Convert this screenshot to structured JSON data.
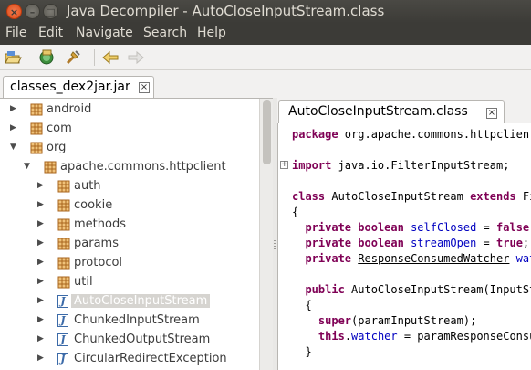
{
  "window": {
    "title": "Java Decompiler - AutoCloseInputStream.class"
  },
  "menu": [
    "File",
    "Edit",
    "Navigate",
    "Search",
    "Help"
  ],
  "toolbar": {
    "buttons": [
      {
        "icon": "open-folder-icon"
      },
      {
        "icon": "open-type-icon"
      },
      {
        "icon": "search-icon"
      },
      {
        "icon": "back-arrow-icon"
      },
      {
        "icon": "forward-arrow-icon"
      }
    ]
  },
  "left_tab": {
    "label": "classes_dex2jar.jar"
  },
  "tree": [
    {
      "label": "android",
      "depth": 0,
      "expanded": false,
      "kind": "package"
    },
    {
      "label": "com",
      "depth": 0,
      "expanded": false,
      "kind": "package"
    },
    {
      "label": "org",
      "depth": 0,
      "expanded": true,
      "kind": "package"
    },
    {
      "label": "apache.commons.httpclient",
      "depth": 1,
      "expanded": true,
      "kind": "package"
    },
    {
      "label": "auth",
      "depth": 2,
      "expanded": false,
      "kind": "package"
    },
    {
      "label": "cookie",
      "depth": 2,
      "expanded": false,
      "kind": "package"
    },
    {
      "label": "methods",
      "depth": 2,
      "expanded": false,
      "kind": "package"
    },
    {
      "label": "params",
      "depth": 2,
      "expanded": false,
      "kind": "package"
    },
    {
      "label": "protocol",
      "depth": 2,
      "expanded": false,
      "kind": "package"
    },
    {
      "label": "util",
      "depth": 2,
      "expanded": false,
      "kind": "package"
    },
    {
      "label": "AutoCloseInputStream",
      "depth": 2,
      "expanded": false,
      "kind": "class",
      "selected": true
    },
    {
      "label": "ChunkedInputStream",
      "depth": 2,
      "expanded": false,
      "kind": "class"
    },
    {
      "label": "ChunkedOutputStream",
      "depth": 2,
      "expanded": false,
      "kind": "class"
    },
    {
      "label": "CircularRedirectException",
      "depth": 2,
      "expanded": false,
      "kind": "class"
    }
  ],
  "right_tab": {
    "label": "AutoCloseInputStream.class"
  },
  "code_lines": [
    [
      {
        "t": "package",
        "s": "kw"
      },
      {
        "t": " org.apache.commons.httpclient"
      }
    ],
    [],
    [
      {
        "t": "import",
        "s": "kw"
      },
      {
        "t": " java.io.FilterInputStream;"
      }
    ],
    [],
    [
      {
        "t": "class",
        "s": "kw"
      },
      {
        "t": " AutoCloseInputStream "
      },
      {
        "t": "extends",
        "s": "kw"
      },
      {
        "t": " Fi"
      }
    ],
    [
      {
        "t": "{"
      }
    ],
    [
      {
        "t": "  "
      },
      {
        "t": "private",
        "s": "kw"
      },
      {
        "t": " "
      },
      {
        "t": "boolean",
        "s": "kw"
      },
      {
        "t": " "
      },
      {
        "t": "selfClosed",
        "s": "fld"
      },
      {
        "t": " = "
      },
      {
        "t": "false",
        "s": "kw"
      },
      {
        "t": ";"
      }
    ],
    [
      {
        "t": "  "
      },
      {
        "t": "private",
        "s": "kw"
      },
      {
        "t": " "
      },
      {
        "t": "boolean",
        "s": "kw"
      },
      {
        "t": " "
      },
      {
        "t": "streamOpen",
        "s": "fld"
      },
      {
        "t": " = "
      },
      {
        "t": "true",
        "s": "kw"
      },
      {
        "t": ";"
      }
    ],
    [
      {
        "t": "  "
      },
      {
        "t": "private",
        "s": "kw"
      },
      {
        "t": " "
      },
      {
        "t": "ResponseConsumedWatcher",
        "s": "ul"
      },
      {
        "t": " "
      },
      {
        "t": "wat",
        "s": "fld"
      }
    ],
    [],
    [
      {
        "t": "  "
      },
      {
        "t": "public",
        "s": "kw"
      },
      {
        "t": " AutoCloseInputStream(InputSt"
      }
    ],
    [
      {
        "t": "  {"
      }
    ],
    [
      {
        "t": "    "
      },
      {
        "t": "super",
        "s": "kw"
      },
      {
        "t": "(paramInputStream);"
      }
    ],
    [
      {
        "t": "    "
      },
      {
        "t": "this",
        "s": "kw"
      },
      {
        "t": "."
      },
      {
        "t": "watcher",
        "s": "fld"
      },
      {
        "t": " = paramResponseConsu"
      }
    ],
    [
      {
        "t": "  }"
      }
    ]
  ]
}
